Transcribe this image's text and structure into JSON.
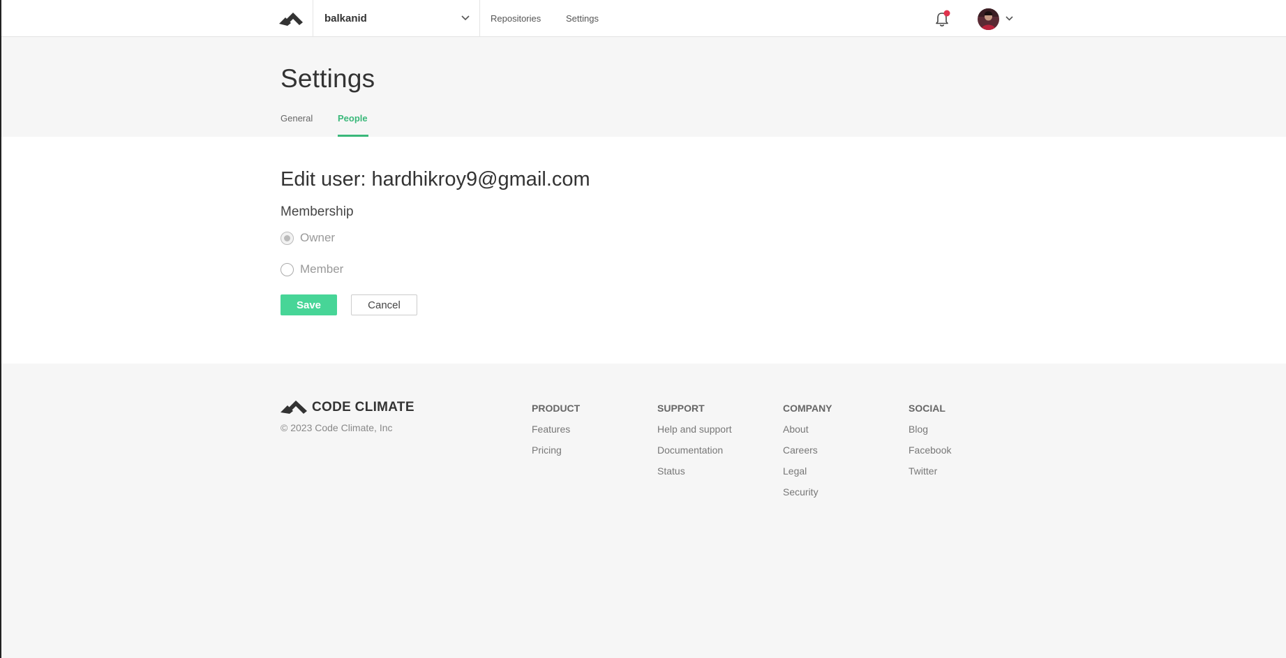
{
  "topnav": {
    "org_name": "balkanid",
    "links": {
      "repositories": "Repositories",
      "settings": "Settings"
    }
  },
  "header": {
    "title": "Settings",
    "tabs": [
      {
        "label": "General",
        "active": false
      },
      {
        "label": "People",
        "active": true
      }
    ]
  },
  "form": {
    "title": "Edit user: hardhikroy9@gmail.com",
    "membership_label": "Membership",
    "options": [
      {
        "label": "Owner",
        "checked": true
      },
      {
        "label": "Member",
        "checked": false
      }
    ],
    "save_label": "Save",
    "cancel_label": "Cancel"
  },
  "footer": {
    "brand": "CODE CLIMATE",
    "copyright": "© 2023 Code Climate, Inc",
    "columns": [
      {
        "heading": "PRODUCT",
        "links": [
          "Features",
          "Pricing"
        ]
      },
      {
        "heading": "SUPPORT",
        "links": [
          "Help and support",
          "Documentation",
          "Status"
        ]
      },
      {
        "heading": "COMPANY",
        "links": [
          "About",
          "Careers",
          "Legal",
          "Security"
        ]
      },
      {
        "heading": "SOCIAL",
        "links": [
          "Blog",
          "Facebook",
          "Twitter"
        ]
      }
    ]
  },
  "colors": {
    "accent_green": "#3ab87a",
    "save_button": "#47d597",
    "notification_dot": "#e0334d"
  },
  "icons": [
    "code-climate-logo-icon",
    "chevron-down-icon",
    "bell-icon",
    "notification-dot-icon",
    "avatar"
  ]
}
